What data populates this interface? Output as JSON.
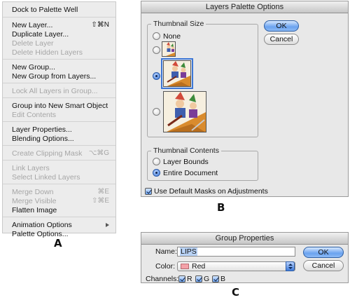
{
  "menu": {
    "items": [
      {
        "label": "Dock to Palette Well",
        "shortcut": "",
        "disabled": false,
        "submenu": false
      },
      {
        "label": "New Layer...",
        "shortcut": "⇧⌘N",
        "disabled": false,
        "submenu": false
      },
      {
        "label": "Duplicate Layer...",
        "shortcut": "",
        "disabled": false,
        "submenu": false
      },
      {
        "label": "Delete Layer",
        "shortcut": "",
        "disabled": true,
        "submenu": false
      },
      {
        "label": "Delete Hidden Layers",
        "shortcut": "",
        "disabled": true,
        "submenu": false
      },
      {
        "label": "New Group...",
        "shortcut": "",
        "disabled": false,
        "submenu": false
      },
      {
        "label": "New Group from Layers...",
        "shortcut": "",
        "disabled": false,
        "submenu": false
      },
      {
        "label": "Lock All Layers in Group...",
        "shortcut": "",
        "disabled": true,
        "submenu": false
      },
      {
        "label": "Group into New Smart Object",
        "shortcut": "",
        "disabled": false,
        "submenu": false
      },
      {
        "label": "Edit Contents",
        "shortcut": "",
        "disabled": true,
        "submenu": false
      },
      {
        "label": "Layer Properties...",
        "shortcut": "",
        "disabled": false,
        "submenu": false
      },
      {
        "label": "Blending Options...",
        "shortcut": "",
        "disabled": false,
        "submenu": false
      },
      {
        "label": "Create Clipping Mask",
        "shortcut": "⌥⌘G",
        "disabled": true,
        "submenu": false
      },
      {
        "label": "Link Layers",
        "shortcut": "",
        "disabled": true,
        "submenu": false
      },
      {
        "label": "Select Linked Layers",
        "shortcut": "",
        "disabled": true,
        "submenu": false
      },
      {
        "label": "Merge Down",
        "shortcut": "⌘E",
        "disabled": true,
        "submenu": false
      },
      {
        "label": "Merge Visible",
        "shortcut": "⇧⌘E",
        "disabled": true,
        "submenu": false
      },
      {
        "label": "Flatten Image",
        "shortcut": "",
        "disabled": false,
        "submenu": false
      },
      {
        "label": "Animation Options",
        "shortcut": "",
        "disabled": false,
        "submenu": true
      },
      {
        "label": "Palette Options...",
        "shortcut": "",
        "disabled": false,
        "submenu": false
      }
    ],
    "figure_label": "A"
  },
  "layers_dialog": {
    "title": "Layers Palette Options",
    "thumbnail_size": {
      "title": "Thumbnail Size",
      "none_label": "None",
      "selected": "medium"
    },
    "thumbnail_contents": {
      "title": "Thumbnail Contents",
      "options": [
        "Layer Bounds",
        "Entire Document"
      ],
      "selected": "Entire Document"
    },
    "use_default_masks": {
      "label": "Use Default Masks on Adjustments",
      "checked": true
    },
    "ok_label": "OK",
    "cancel_label": "Cancel",
    "figure_label": "B"
  },
  "group_dialog": {
    "title": "Group Properties",
    "name_label": "Name:",
    "name_value": "LIPS",
    "color_label": "Color:",
    "color_value": "Red",
    "color_swatch": "#f4a1a8",
    "channels_label": "Channels:",
    "channels": [
      {
        "label": "R",
        "checked": true
      },
      {
        "label": "G",
        "checked": true
      },
      {
        "label": "B",
        "checked": true
      }
    ],
    "ok_label": "OK",
    "cancel_label": "Cancel",
    "figure_label": "C"
  },
  "colors": {
    "accent": "#3b76d6",
    "menu_bg": "#ececec",
    "dialog_bg": "#e8e8e8",
    "disabled_text": "#a6a6a6"
  }
}
